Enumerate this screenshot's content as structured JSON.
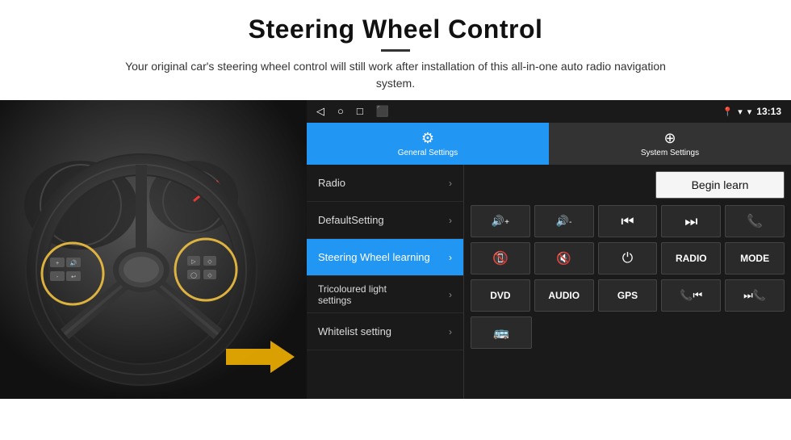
{
  "header": {
    "title": "Steering Wheel Control",
    "subtitle": "Your original car's steering wheel control will still work after installation of this all-in-one auto radio navigation system."
  },
  "status_bar": {
    "time": "13:13",
    "icons": [
      "◁",
      "○",
      "□",
      "⬛"
    ]
  },
  "tabs": [
    {
      "label": "General Settings",
      "icon": "⚙",
      "active": true
    },
    {
      "label": "System Settings",
      "icon": "🌐",
      "active": false
    }
  ],
  "menu": {
    "items": [
      {
        "label": "Radio",
        "active": false
      },
      {
        "label": "DefaultSetting",
        "active": false
      },
      {
        "label": "Steering Wheel learning",
        "active": true
      },
      {
        "label": "Tricoloured light settings",
        "active": false
      },
      {
        "label": "Whitelist setting",
        "active": false
      }
    ]
  },
  "controls": {
    "begin_learn_label": "Begin learn",
    "row1": [
      {
        "icon": "🔊+",
        "label": "vol up"
      },
      {
        "icon": "🔊-",
        "label": "vol down"
      },
      {
        "icon": "⏮",
        "label": "prev"
      },
      {
        "icon": "⏭",
        "label": "next"
      },
      {
        "icon": "📞",
        "label": "phone"
      }
    ],
    "row2": [
      {
        "icon": "📞↩",
        "label": "hang up"
      },
      {
        "icon": "🔇",
        "label": "mute"
      },
      {
        "icon": "⏻",
        "label": "power"
      },
      {
        "icon": "RADIO",
        "label": "radio",
        "text": true
      },
      {
        "icon": "MODE",
        "label": "mode",
        "text": true
      }
    ],
    "row3": [
      {
        "icon": "DVD",
        "label": "dvd",
        "text": true
      },
      {
        "icon": "AUDIO",
        "label": "audio",
        "text": true
      },
      {
        "icon": "GPS",
        "label": "gps",
        "text": true
      },
      {
        "icon": "📞⏮",
        "label": "phone prev"
      },
      {
        "icon": "⏮📞",
        "label": "phone next"
      }
    ],
    "row4_icon": "🚌"
  }
}
